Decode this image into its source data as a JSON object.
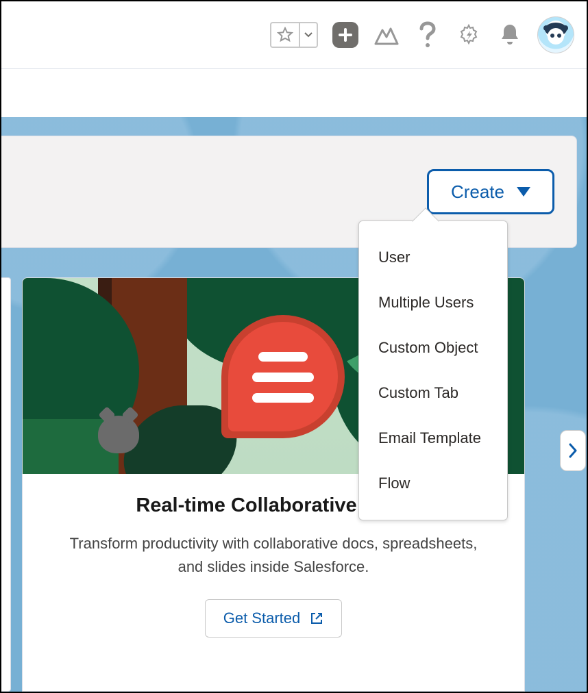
{
  "header": {
    "favorite_state": "unstarred"
  },
  "create_menu": {
    "button_label": "Create",
    "items": [
      "User",
      "Multiple Users",
      "Custom Object",
      "Custom Tab",
      "Email Template",
      "Flow"
    ]
  },
  "carousel_card": {
    "title": "Real-time Collaborative Docs",
    "description": "Transform productivity with collaborative docs, spreadsheets, and slides inside Salesforce.",
    "cta_label": "Get Started"
  }
}
